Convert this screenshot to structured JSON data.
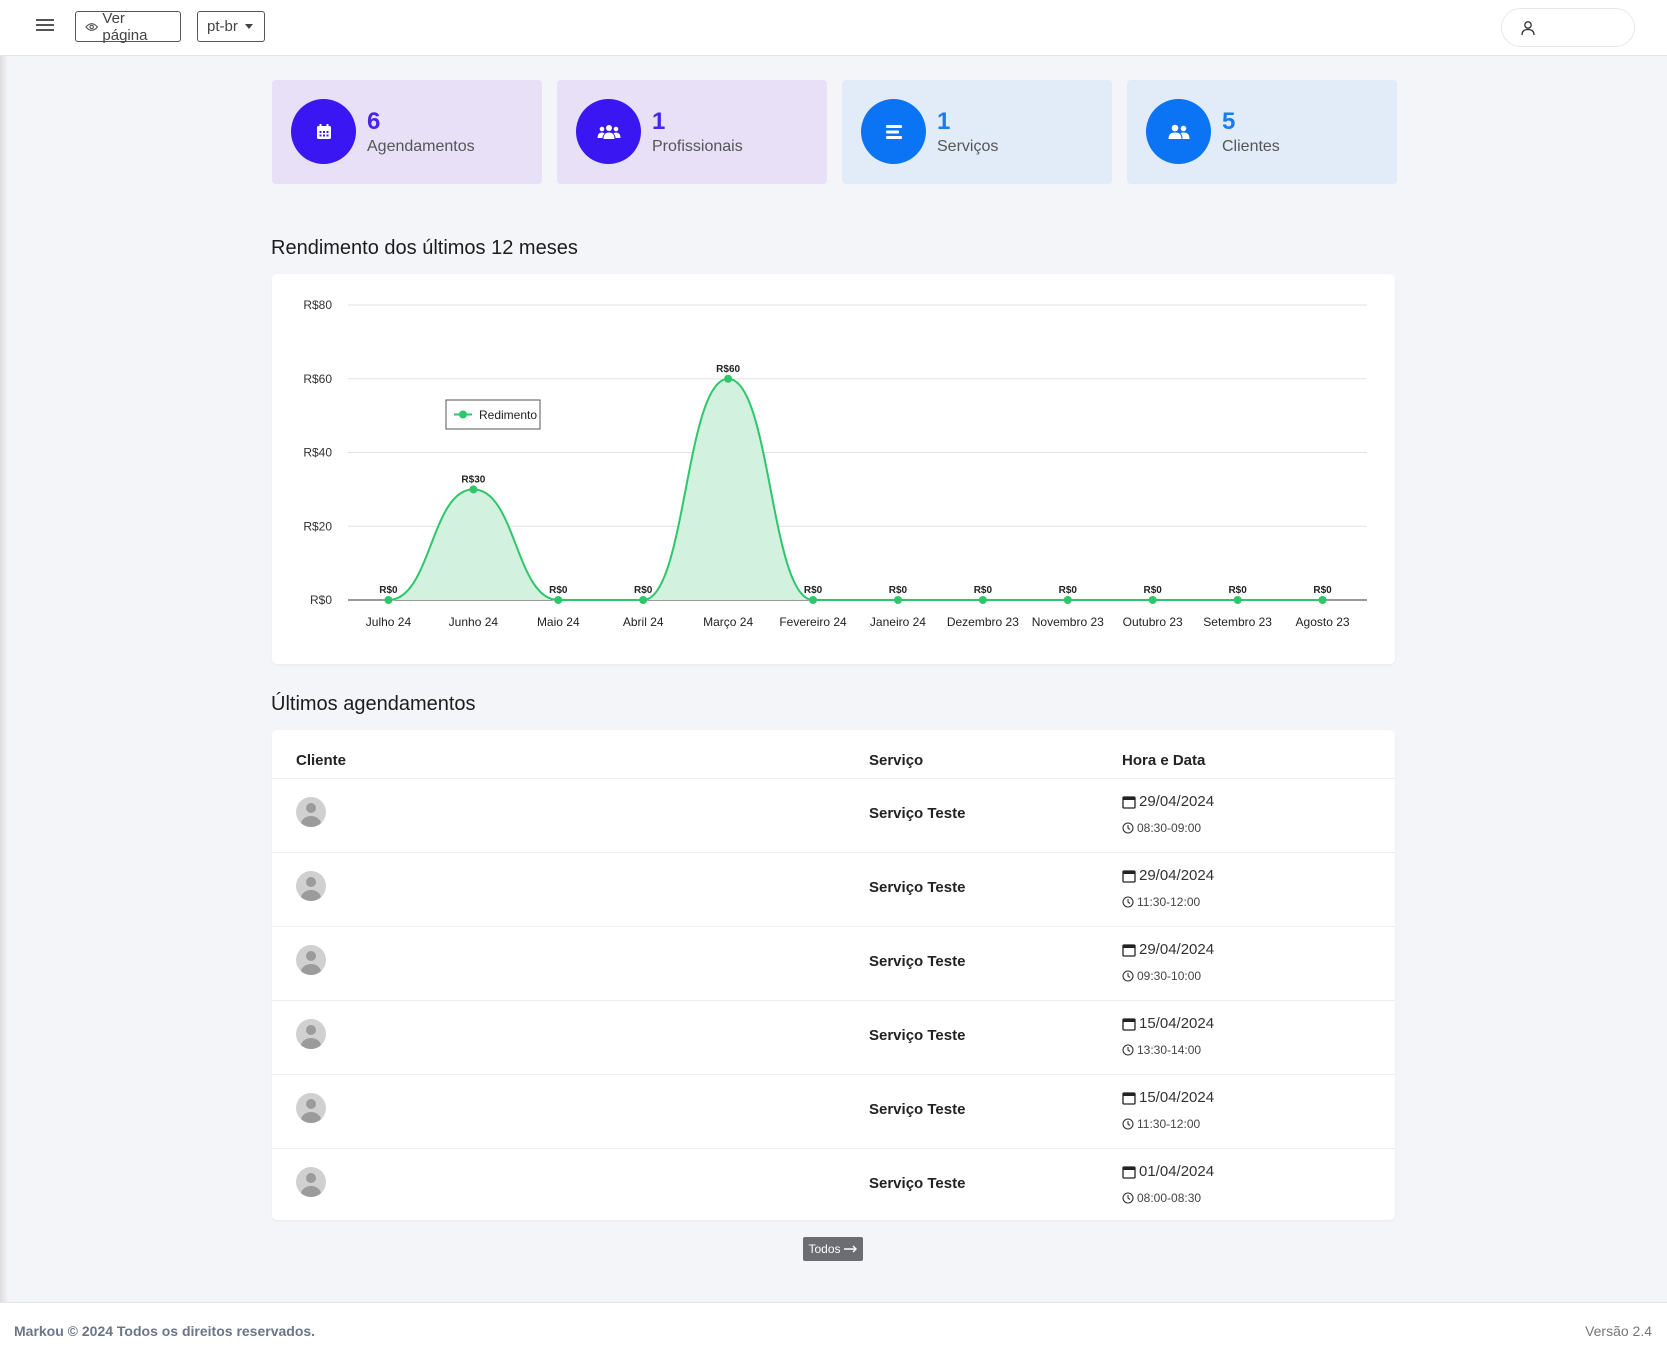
{
  "topbar": {
    "view_page_label": "Ver página",
    "language": "pt-br"
  },
  "stats": [
    {
      "value": "6",
      "label": "Agendamentos",
      "icon": "calendar-icon"
    },
    {
      "value": "1",
      "label": "Profissionais",
      "icon": "users-icon"
    },
    {
      "value": "1",
      "label": "Serviços",
      "icon": "list-icon"
    },
    {
      "value": "5",
      "label": "Clientes",
      "icon": "user-group-icon"
    }
  ],
  "colors": {
    "purple_accent": "#3a17f2",
    "blue_accent": "#0b74f4",
    "series_line": "#2ec66b",
    "series_fill": "#d3f1df"
  },
  "chart_section_title": "Rendimento dos últimos 12 meses",
  "chart_data": {
    "type": "area",
    "categories": [
      "Julho 24",
      "Junho 24",
      "Maio 24",
      "Abril 24",
      "Março 24",
      "Fevereiro 24",
      "Janeiro 24",
      "Dezembro 23",
      "Novembro 23",
      "Outubro 23",
      "Setembro 23",
      "Agosto 23"
    ],
    "series": [
      {
        "name": "Redimento",
        "values": [
          0,
          30,
          0,
          0,
          60,
          0,
          0,
          0,
          0,
          0,
          0,
          0
        ]
      }
    ],
    "data_labels": [
      "R$0",
      "R$30",
      "R$0",
      "R$0",
      "R$60",
      "R$0",
      "R$0",
      "R$0",
      "R$0",
      "R$0",
      "R$0",
      "R$0"
    ],
    "ylim": [
      0,
      80
    ],
    "y_ticks": [
      0,
      20,
      40,
      60,
      80
    ],
    "y_tick_labels": [
      "R$0",
      "R$20",
      "R$40",
      "R$60",
      "R$80"
    ],
    "grid": true,
    "legend": "top-left"
  },
  "appointments": {
    "title": "Últimos agendamentos",
    "headers": {
      "client": "Cliente",
      "service": "Serviço",
      "datetime": "Hora e Data"
    },
    "rows": [
      {
        "service": "Serviço Teste",
        "date": "29/04/2024",
        "time": "08:30-09:00"
      },
      {
        "service": "Serviço Teste",
        "date": "29/04/2024",
        "time": "11:30-12:00"
      },
      {
        "service": "Serviço Teste",
        "date": "29/04/2024",
        "time": "09:30-10:00"
      },
      {
        "service": "Serviço Teste",
        "date": "15/04/2024",
        "time": "13:30-14:00"
      },
      {
        "service": "Serviço Teste",
        "date": "15/04/2024",
        "time": "11:30-12:00"
      },
      {
        "service": "Serviço Teste",
        "date": "01/04/2024",
        "time": "08:00-08:30"
      }
    ],
    "all_button": "Todos"
  },
  "footer": {
    "copyright": "Markou © 2024 Todos os direitos reservados.",
    "version": "Versão 2.4"
  }
}
